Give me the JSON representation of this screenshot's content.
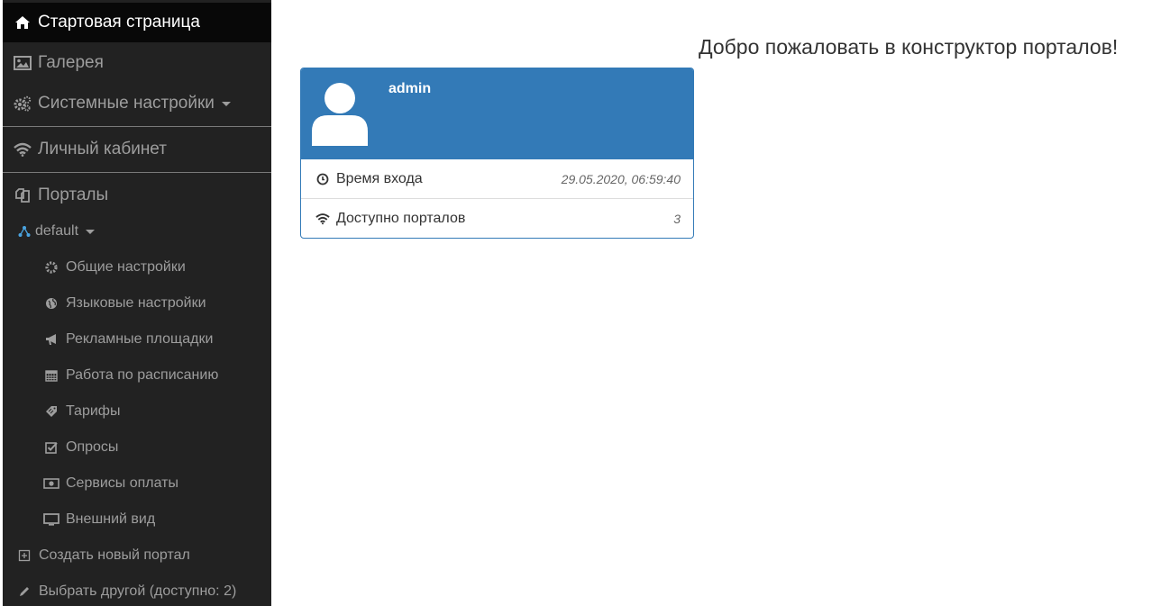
{
  "sidebar": {
    "home": "Стартовая страница",
    "gallery": "Галерея",
    "system_settings": "Системные настройки",
    "cabinet": "Личный кабинет",
    "portals": "Порталы",
    "portal_default": "default",
    "portal_items": [
      {
        "label": "Общие настройки",
        "icon": "gear-icon"
      },
      {
        "label": "Языковые настройки",
        "icon": "globe-icon"
      },
      {
        "label": "Рекламные площадки",
        "icon": "bullhorn-icon"
      },
      {
        "label": "Работа по расписанию",
        "icon": "calendar-icon"
      },
      {
        "label": "Тарифы",
        "icon": "tag-icon"
      },
      {
        "label": "Опросы",
        "icon": "check-icon"
      },
      {
        "label": "Сервисы оплаты",
        "icon": "money-icon"
      },
      {
        "label": "Внешний вид",
        "icon": "monitor-icon"
      }
    ],
    "create_portal": "Создать новый портал",
    "choose_other": "Выбрать другой (доступно: 2)"
  },
  "main": {
    "welcome": "Добро пожаловать в конструктор порталов!",
    "user_card": {
      "username": "admin",
      "login_time_label": "Время входа",
      "login_time_value": "29.05.2020, 06:59:40",
      "portals_label": "Доступно порталов",
      "portals_value": "3"
    }
  },
  "colors": {
    "sidebar_bg": "#222222",
    "sidebar_active_bg": "#080808",
    "sidebar_text": "#9d9d9d",
    "card_primary": "#337ab7"
  }
}
